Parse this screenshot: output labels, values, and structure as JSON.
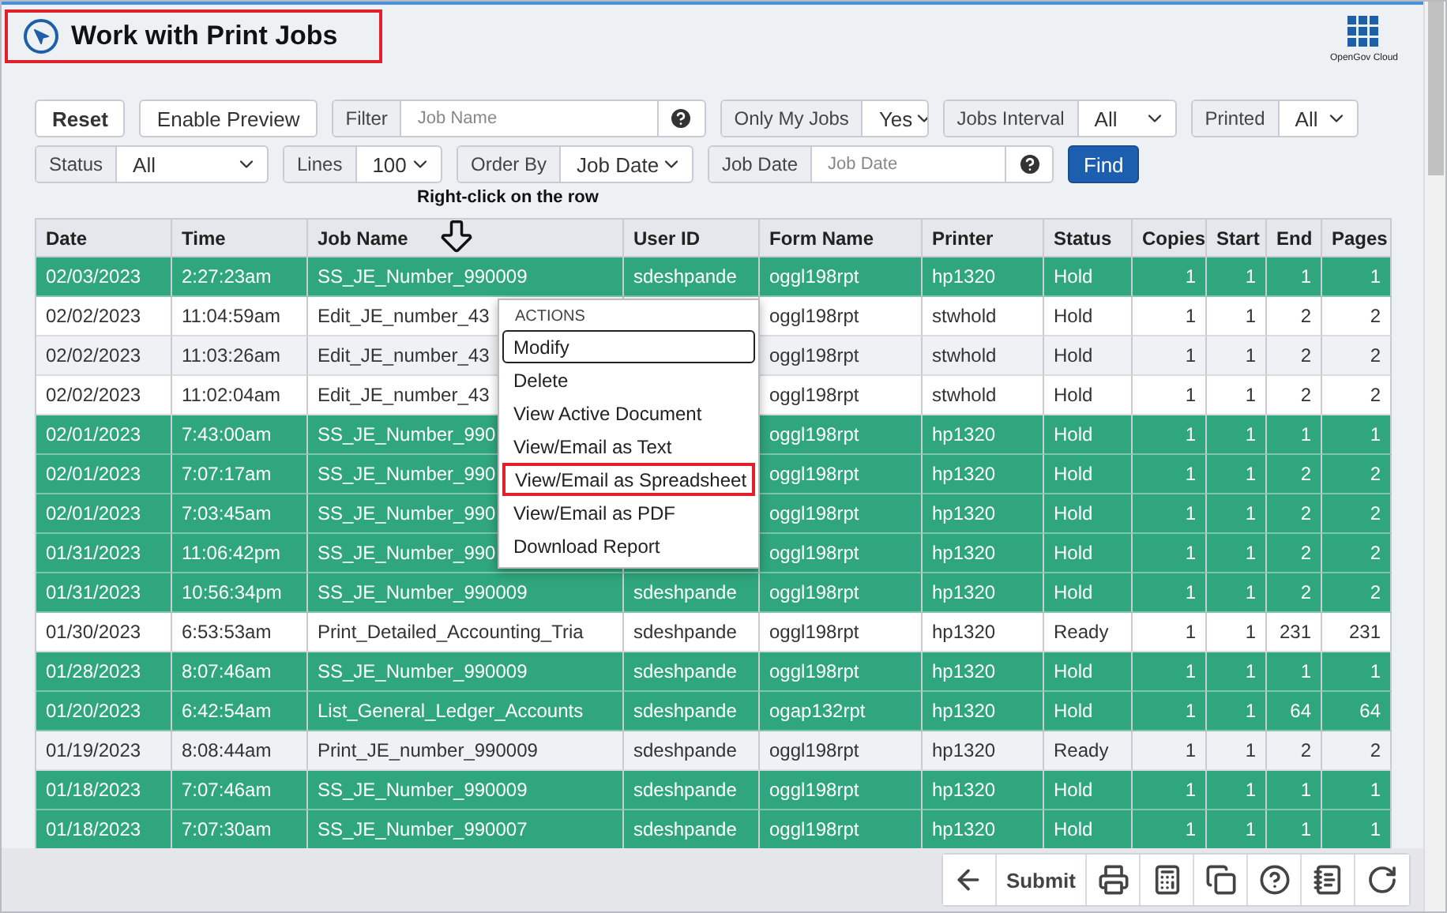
{
  "header": {
    "title": "Work with Print Jobs",
    "brand": "OpenGov Cloud"
  },
  "toolbar": [
    [
      {
        "kind": "button",
        "label": "Reset",
        "bold": true
      },
      {
        "kind": "button",
        "label": "Enable Preview",
        "bold": false
      },
      {
        "kind": "input",
        "label": "Filter",
        "placeholder": "Job Name"
      },
      {
        "kind": "select",
        "label": "Only My Jobs",
        "value": "Yes"
      },
      {
        "kind": "select",
        "label": "Jobs Interval",
        "value": "All"
      },
      {
        "kind": "select",
        "label": "Printed",
        "value": "All"
      }
    ],
    [
      {
        "kind": "select",
        "label": "Status",
        "value": "All"
      },
      {
        "kind": "select",
        "label": "Lines",
        "value": "100"
      },
      {
        "kind": "select",
        "label": "Order By",
        "value": "Job Date"
      },
      {
        "kind": "input",
        "label": "Job Date",
        "placeholder": "Job Date"
      },
      {
        "kind": "primary",
        "label": "Find"
      }
    ]
  ],
  "annotation": "Right-click on the row",
  "table": {
    "columns": [
      "Date",
      "Time",
      "Job Name",
      "User ID",
      "Form Name",
      "Printer",
      "Status",
      "Copies",
      "Start",
      "End",
      "Pages"
    ],
    "rows": [
      {
        "selected": true,
        "cells": [
          "02/03/2023",
          "2:27:23am",
          "SS_JE_Number_990009",
          "sdeshpande",
          "oggl198rpt",
          "hp1320",
          "Hold",
          "1",
          "1",
          "1",
          "1"
        ]
      },
      {
        "selected": false,
        "cells": [
          "02/02/2023",
          "11:04:59am",
          "Edit_JE_number_43",
          "",
          "oggl198rpt",
          "stwhold",
          "Hold",
          "1",
          "1",
          "2",
          "2"
        ]
      },
      {
        "selected": false,
        "cells": [
          "02/02/2023",
          "11:03:26am",
          "Edit_JE_number_43",
          "",
          "oggl198rpt",
          "stwhold",
          "Hold",
          "1",
          "1",
          "2",
          "2"
        ]
      },
      {
        "selected": false,
        "cells": [
          "02/02/2023",
          "11:02:04am",
          "Edit_JE_number_43",
          "",
          "oggl198rpt",
          "stwhold",
          "Hold",
          "1",
          "1",
          "2",
          "2"
        ]
      },
      {
        "selected": true,
        "cells": [
          "02/01/2023",
          "7:43:00am",
          "SS_JE_Number_990",
          "",
          "oggl198rpt",
          "hp1320",
          "Hold",
          "1",
          "1",
          "1",
          "1"
        ]
      },
      {
        "selected": true,
        "cells": [
          "02/01/2023",
          "7:07:17am",
          "SS_JE_Number_990",
          "",
          "oggl198rpt",
          "hp1320",
          "Hold",
          "1",
          "1",
          "2",
          "2"
        ]
      },
      {
        "selected": true,
        "cells": [
          "02/01/2023",
          "7:03:45am",
          "SS_JE_Number_990",
          "",
          "oggl198rpt",
          "hp1320",
          "Hold",
          "1",
          "1",
          "2",
          "2"
        ]
      },
      {
        "selected": true,
        "cells": [
          "01/31/2023",
          "11:06:42pm",
          "SS_JE_Number_990",
          "",
          "oggl198rpt",
          "hp1320",
          "Hold",
          "1",
          "1",
          "2",
          "2"
        ]
      },
      {
        "selected": true,
        "cells": [
          "01/31/2023",
          "10:56:34pm",
          "SS_JE_Number_990009",
          "sdeshpande",
          "oggl198rpt",
          "hp1320",
          "Hold",
          "1",
          "1",
          "2",
          "2"
        ]
      },
      {
        "selected": false,
        "cells": [
          "01/30/2023",
          "6:53:53am",
          "Print_Detailed_Accounting_Tria",
          "sdeshpande",
          "oggl198rpt",
          "hp1320",
          "Ready",
          "1",
          "1",
          "231",
          "231"
        ]
      },
      {
        "selected": true,
        "cells": [
          "01/28/2023",
          "8:07:46am",
          "SS_JE_Number_990009",
          "sdeshpande",
          "oggl198rpt",
          "hp1320",
          "Hold",
          "1",
          "1",
          "1",
          "1"
        ]
      },
      {
        "selected": true,
        "cells": [
          "01/20/2023",
          "6:42:54am",
          "List_General_Ledger_Accounts",
          "sdeshpande",
          "ogap132rpt",
          "hp1320",
          "Hold",
          "1",
          "1",
          "64",
          "64"
        ]
      },
      {
        "selected": false,
        "cells": [
          "01/19/2023",
          "8:08:44am",
          "Print_JE_number_990009",
          "sdeshpande",
          "oggl198rpt",
          "hp1320",
          "Ready",
          "1",
          "1",
          "2",
          "2"
        ]
      },
      {
        "selected": true,
        "cells": [
          "01/18/2023",
          "7:07:46am",
          "SS_JE_Number_990009",
          "sdeshpande",
          "oggl198rpt",
          "hp1320",
          "Hold",
          "1",
          "1",
          "1",
          "1"
        ]
      },
      {
        "selected": true,
        "cells": [
          "01/18/2023",
          "7:07:30am",
          "SS_JE_Number_990007",
          "sdeshpande",
          "oggl198rpt",
          "hp1320",
          "Hold",
          "1",
          "1",
          "1",
          "1"
        ]
      }
    ]
  },
  "menu": {
    "heading": "ACTIONS",
    "items": [
      {
        "label": "Modify",
        "focused": true,
        "highlighted": false
      },
      {
        "label": "Delete",
        "focused": false,
        "highlighted": false
      },
      {
        "label": "View Active Document",
        "focused": false,
        "highlighted": false
      },
      {
        "label": "View/Email as Text",
        "focused": false,
        "highlighted": false
      },
      {
        "label": "View/Email as Spreadsheet",
        "focused": false,
        "highlighted": true
      },
      {
        "label": "View/Email as PDF",
        "focused": false,
        "highlighted": false
      },
      {
        "label": "Download Report",
        "focused": false,
        "highlighted": false
      }
    ]
  },
  "footer": [
    {
      "kind": "back"
    },
    {
      "kind": "text",
      "label": "Submit"
    },
    {
      "kind": "print"
    },
    {
      "kind": "calculator"
    },
    {
      "kind": "copy"
    },
    {
      "kind": "help"
    },
    {
      "kind": "notes"
    },
    {
      "kind": "refresh"
    }
  ]
}
